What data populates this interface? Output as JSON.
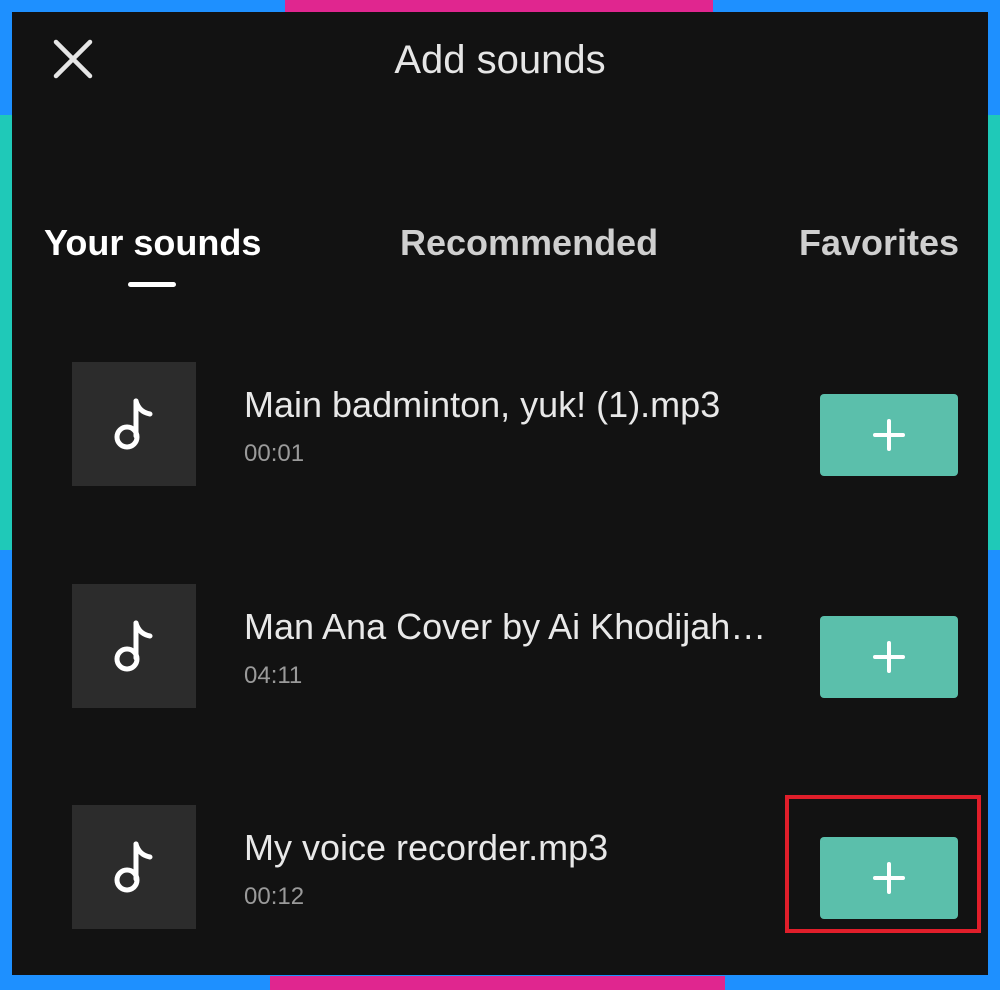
{
  "header": {
    "title": "Add sounds",
    "close_icon": "close-icon"
  },
  "tabs": [
    {
      "label": "Your sounds",
      "active": true
    },
    {
      "label": "Recommended",
      "active": false
    },
    {
      "label": "Favorites",
      "active": false
    }
  ],
  "sounds": [
    {
      "name": "Main badminton, yuk! (1).mp3",
      "duration": "00:01",
      "icon": "music-note-icon",
      "action_icon": "plus-icon"
    },
    {
      "name": "Man Ana Cover by Ai Khodijah…",
      "duration": "04:11",
      "icon": "music-note-icon",
      "action_icon": "plus-icon"
    },
    {
      "name": "My voice recorder.mp3",
      "duration": "00:12",
      "icon": "music-note-icon",
      "action_icon": "plus-icon",
      "highlighted": true
    }
  ],
  "colors": {
    "background": "#121212",
    "thumbnail": "#2c2c2c",
    "add_button": "#5bbfab",
    "highlight": "#e01e2a",
    "frame_blue": "#1e90ff",
    "frame_pink": "#e0268f",
    "frame_teal": "#1fc9b8"
  }
}
